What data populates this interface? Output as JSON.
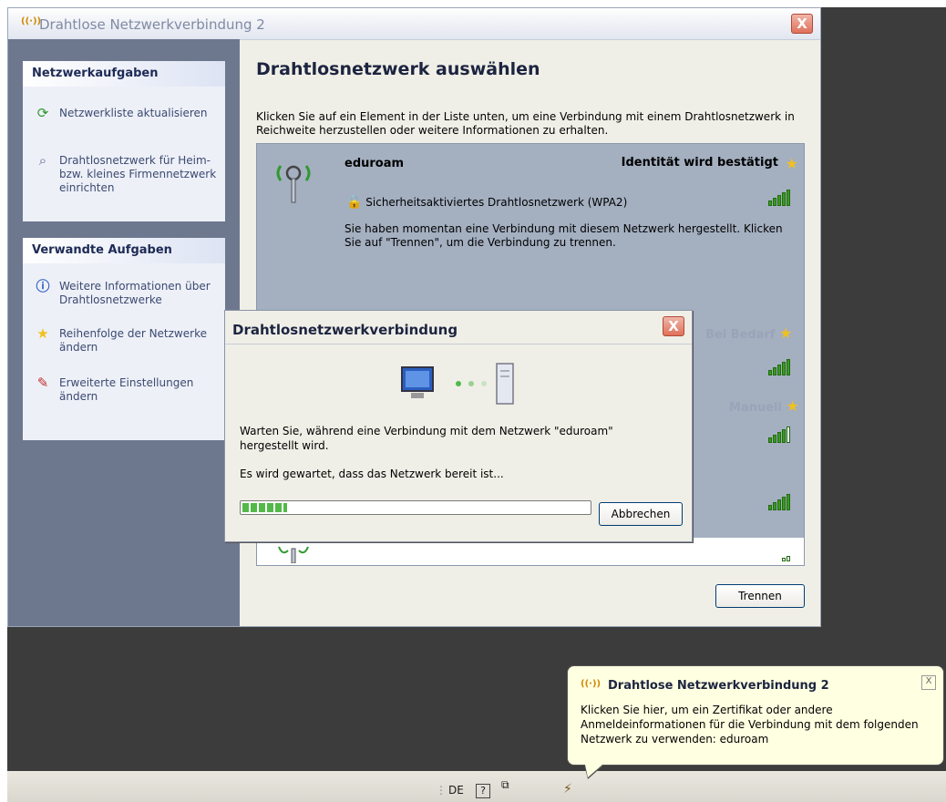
{
  "window": {
    "title": "Drahtlose Netzwerkverbindung 2",
    "close_label": "X"
  },
  "sidebar": {
    "network_tasks": {
      "heading": "Netzwerkaufgaben",
      "items": [
        {
          "label": "Netzwerkliste aktualisieren",
          "icon": "refresh-icon"
        },
        {
          "label": "Drahtlosnetzwerk für Heim- bzw. kleines Firmennetzwerk einrichten",
          "icon": "wireless-setup-icon"
        }
      ]
    },
    "related_tasks": {
      "heading": "Verwandte Aufgaben",
      "items": [
        {
          "label": "Weitere Informationen über Drahtlosnetzwerke",
          "icon": "info-icon"
        },
        {
          "label": "Reihenfolge der Netzwerke ändern",
          "icon": "star-icon"
        },
        {
          "label": "Erweiterte Einstellungen ändern",
          "icon": "settings-icon"
        }
      ]
    }
  },
  "main": {
    "title": "Drahtlosnetzwerk auswählen",
    "intro": "Klicken Sie auf ein Element in der Liste unten, um eine Verbindung mit einem Drahtlosnetzwerk in Reichweite herzustellen oder weitere Informationen zu erhalten.",
    "networks": [
      {
        "name": "eduroam",
        "status": "Identität wird bestätigt",
        "security": "Sicherheitsaktiviertes Drahtlosnetzwerk (WPA2)",
        "description": "Sie haben momentan eine Verbindung mit diesem Netzwerk hergestellt. Klicken Sie auf \"Trennen\", um die Verbindung zu trennen.",
        "signal_bars": 5
      },
      {
        "name": "",
        "status": "Bei Bedarf",
        "signal_bars": 5
      },
      {
        "name": "",
        "status": "Manuell",
        "signal_bars": 4
      },
      {
        "name": "",
        "status": "",
        "signal_bars": 5
      },
      {
        "name": "",
        "status": "",
        "signal_bars": 1
      }
    ],
    "disconnect_label": "Trennen"
  },
  "dialog": {
    "title": "Drahtlosnetzwerkverbindung",
    "close_label": "X",
    "message1": "Warten Sie, während eine Verbindung mit dem Netzwerk \"eduroam\" hergestellt wird.",
    "message2": "Es wird gewartet, dass das Netzwerk bereit ist...",
    "progress_fraction": 0.13,
    "cancel_label": "Abbrechen"
  },
  "taskbar": {
    "language": "DE",
    "help_label": "?"
  },
  "balloon": {
    "title": "Drahtlose Netzwerkverbindung 2",
    "body": "Klicken Sie hier, um ein Zertifikat oder andere Anmeldeinformationen für die Verbindung mit dem folgenden Netzwerk zu verwenden: eduroam",
    "close_label": "X"
  },
  "colors": {
    "signal_green": "#3a9a20",
    "star_gold": "#f0c020",
    "selected_row": "#a4afc0",
    "sidebar_bg": "#6d788e"
  }
}
